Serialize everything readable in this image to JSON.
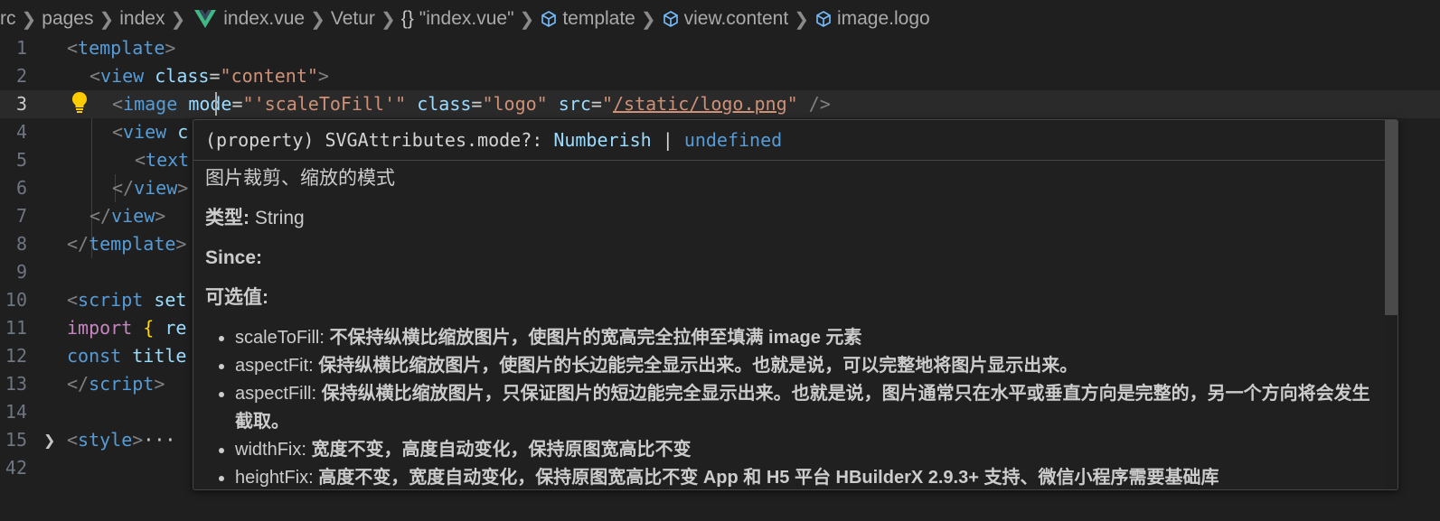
{
  "breadcrumb": {
    "items": [
      "rc",
      "pages",
      "index",
      "index.vue",
      "Vetur",
      "\"index.vue\"",
      "template",
      "view.content",
      "image.logo"
    ],
    "braces": "{}"
  },
  "editor": {
    "lines": [
      {
        "n": "1"
      },
      {
        "n": "2"
      },
      {
        "n": "3"
      },
      {
        "n": "4"
      },
      {
        "n": "5"
      },
      {
        "n": "6"
      },
      {
        "n": "7"
      },
      {
        "n": "8"
      },
      {
        "n": "9"
      },
      {
        "n": "10"
      },
      {
        "n": "11"
      },
      {
        "n": "12"
      },
      {
        "n": "13"
      },
      {
        "n": "14"
      },
      {
        "n": "15"
      },
      {
        "n": "42"
      }
    ],
    "code": {
      "l1_tag": "template",
      "l2_tag": "view",
      "l2_attr": "class",
      "l2_val": "\"content\"",
      "l3_tag": "image",
      "l3_attr1": "mode",
      "l3_val1": "\"'scaleToFill'\"",
      "l3_attr2": "class",
      "l3_val2": "\"logo\"",
      "l3_attr3": "src",
      "l3_val3_open": "\"",
      "l3_val3_link": "/static/logo.png",
      "l3_val3_close": "\"",
      "l4_tag": "view",
      "l4_rest": "c",
      "l5_tag": "text",
      "l6_tag": "view",
      "l7_tag": "view",
      "l8_tag": "template",
      "l10_tag": "script",
      "l10_rest": "set",
      "l11_kw": "import",
      "l11_rest": "re",
      "l12_kw": "const",
      "l12_rest": "title",
      "l13_tag": "script",
      "l15_tag": "style",
      "l15_ellipsis": "···"
    }
  },
  "hover": {
    "signature_prefix": "(property) SVGAttributes.mode?: ",
    "signature_type": "Numberish",
    "signature_sep": " | ",
    "signature_undefined": "undefined",
    "description": "图片裁剪、缩放的模式",
    "type_label": "类型:",
    "type_value": " String",
    "since_label": "Since:",
    "options_label": "可选值:",
    "options": [
      {
        "name": "scaleToFill:",
        "desc": "不保持纵横比缩放图片，使图片的宽高完全拉伸至填满 image 元素"
      },
      {
        "name": "aspectFit:",
        "desc": "保持纵横比缩放图片，使图片的长边能完全显示出来。也就是说，可以完整地将图片显示出来。"
      },
      {
        "name": "aspectFill:",
        "desc": "保持纵横比缩放图片，只保证图片的短边能完全显示出来。也就是说，图片通常只在水平或垂直方向是完整的，另一个方向将会发生截取。"
      },
      {
        "name": "widthFix:",
        "desc": "宽度不变，高度自动变化，保持原图宽高比不变"
      },
      {
        "name": "heightFix:",
        "desc": "高度不变，宽度自动变化，保持原图宽高比不变 App 和 H5 平台 HBuilderX 2.9.3+ 支持、微信小程序需要基础库"
      }
    ]
  },
  "colors": {
    "background": "#1f1f1f",
    "tag": "#569cd6",
    "attribute": "#9cdcfe",
    "string": "#ce9178",
    "keyword": "#c586c0",
    "vue_green": "#41b883"
  }
}
